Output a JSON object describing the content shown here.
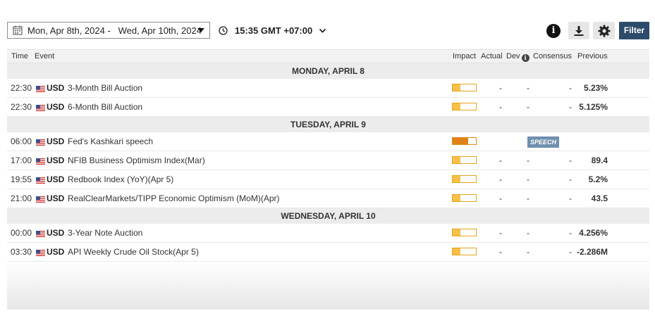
{
  "toolbar": {
    "date_range": "Mon, Apr 8th, 2024 -   Wed, Apr 10th, 2024",
    "time": "15:35 GMT +07:00",
    "info_label": "i",
    "filter_label": "Filter"
  },
  "columns": {
    "time": "Time",
    "event": "Event",
    "impact": "Impact",
    "actual": "Actual",
    "dev": "Dev",
    "consensus": "Consensus",
    "previous": "Previous"
  },
  "days": [
    {
      "label": "MONDAY, APRIL 8",
      "events": [
        {
          "time": "22:30",
          "currency": "USD",
          "name": "3-Month Bill Auction",
          "impact": 0.33,
          "actual": "-",
          "dev": "-",
          "consensus": "-",
          "previous": "5.23%"
        },
        {
          "time": "22:30",
          "currency": "USD",
          "name": "6-Month Bill Auction",
          "impact": 0.33,
          "actual": "-",
          "dev": "-",
          "consensus": "-",
          "previous": "5.125%"
        }
      ]
    },
    {
      "label": "TUESDAY, APRIL 9",
      "events": [
        {
          "time": "06:00",
          "currency": "USD",
          "name": "Fed's Kashkari speech",
          "impact": 0.66,
          "badge": "SPEECH"
        },
        {
          "time": "17:00",
          "currency": "USD",
          "name": "NFIB Business Optimism Index(Mar)",
          "impact": 0.33,
          "actual": "-",
          "dev": "-",
          "consensus": "-",
          "previous": "89.4"
        },
        {
          "time": "19:55",
          "currency": "USD",
          "name": "Redbook Index (YoY)(Apr 5)",
          "impact": 0.33,
          "actual": "-",
          "dev": "-",
          "consensus": "-",
          "previous": "5.2%"
        },
        {
          "time": "21:00",
          "currency": "USD",
          "name": "RealClearMarkets/TIPP Economic Optimism (MoM)(Apr)",
          "impact": 0.33,
          "actual": "-",
          "dev": "-",
          "consensus": "-",
          "previous": "43.5"
        }
      ]
    },
    {
      "label": "WEDNESDAY, APRIL 10",
      "events": [
        {
          "time": "00:00",
          "currency": "USD",
          "name": "3-Year Note Auction",
          "impact": 0.33,
          "actual": "-",
          "dev": "-",
          "consensus": "-",
          "previous": "4.256%"
        },
        {
          "time": "03:30",
          "currency": "USD",
          "name": "API Weekly Crude Oil Stock(Apr 5)",
          "impact": 0.33,
          "actual": "-",
          "dev": "-",
          "consensus": "-",
          "previous": "-2.286M"
        }
      ]
    }
  ],
  "colors": {
    "impact_low": "#f6c14a",
    "impact_high": "#e0821a",
    "filter_button": "#2d4b6b",
    "speech_badge": "#6f8faf"
  },
  "icons": {
    "calendar": "calendar-icon",
    "clock": "clock-icon",
    "chevron": "chevron-down-icon",
    "info": "info-icon",
    "download": "download-icon",
    "settings": "gear-icon",
    "flag": "us-flag-icon"
  }
}
